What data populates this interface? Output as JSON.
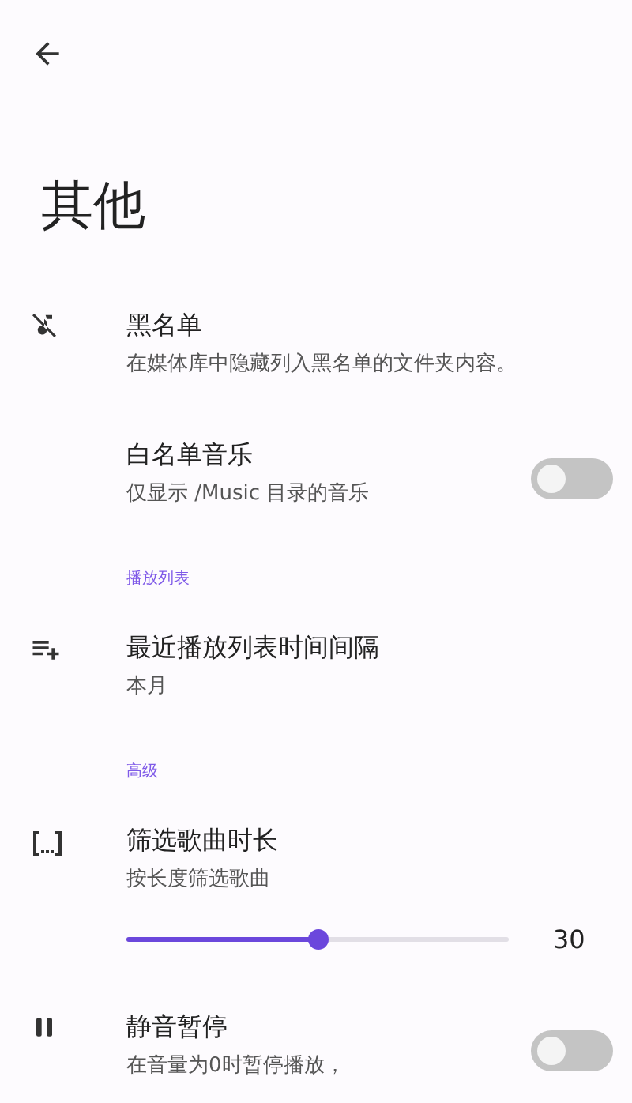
{
  "title": "其他",
  "items": [
    {
      "kind": "plain",
      "title": "黑名单",
      "subtitle": "在媒体库中隐藏列入黑名单的文件夹内容。"
    },
    {
      "kind": "toggle",
      "title": "白名单音乐",
      "subtitle": "仅显示 /Music 目录的音乐",
      "on": false
    },
    {
      "kind": "category",
      "title": "播放列表"
    },
    {
      "kind": "plain",
      "title": "最近播放列表时间间隔",
      "subtitle": "本月"
    },
    {
      "kind": "category",
      "title": "高级"
    },
    {
      "kind": "slider",
      "title": "筛选歌曲时长",
      "subtitle": "按长度筛选歌曲",
      "level": 0.5,
      "reading": "30"
    },
    {
      "kind": "toggle",
      "title": "静音暂停",
      "subtitle": "在音量为0时暂停播放，",
      "on": false
    }
  ]
}
